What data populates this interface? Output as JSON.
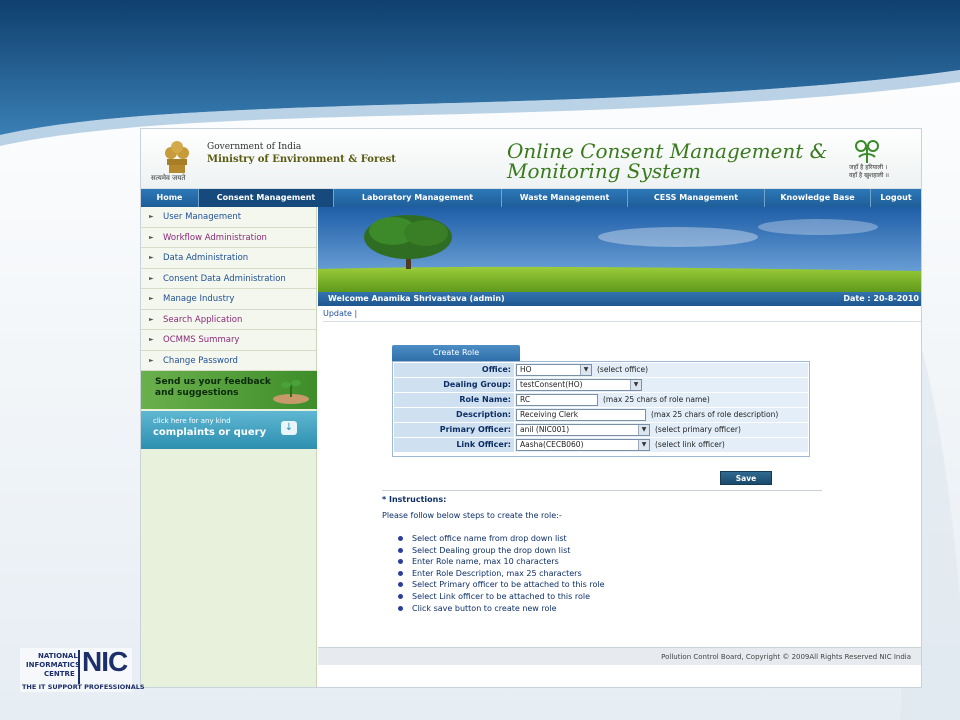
{
  "header": {
    "motto": "सत्यमेव जयते",
    "gov_line": "Government of India",
    "ministry_line": "Ministry of Environment & Forest",
    "app_title_line1": "Online Consent Management &",
    "app_title_line2": "Monitoring System",
    "env_logo_text_1": "जहाँ है हरियाली ।",
    "env_logo_text_2": "वहाँ है खुशहाली ॥"
  },
  "nav": {
    "items": [
      {
        "label": "Home"
      },
      {
        "label": "Consent Management"
      },
      {
        "label": "Laboratory Management"
      },
      {
        "label": "Waste Management"
      },
      {
        "label": "CESS Management"
      },
      {
        "label": "Knowledge Base"
      },
      {
        "label": "Logout"
      }
    ]
  },
  "sidebar": {
    "items": [
      {
        "label": "User Management"
      },
      {
        "label": "Workflow Administration"
      },
      {
        "label": "Data Administration"
      },
      {
        "label": "Consent Data Administration"
      },
      {
        "label": "Manage Industry"
      },
      {
        "label": "Search Application"
      },
      {
        "label": "OCMMS Summary"
      },
      {
        "label": "Change Password"
      }
    ],
    "feedback_line1": "Send us your feedback",
    "feedback_line2": "and suggestions",
    "complaint_line1": "click here for any kind",
    "complaint_line2": "complaints or query"
  },
  "content": {
    "welcome": "Welcome Anamika Shrivastava (admin)",
    "date": "Date : 20-8-2010",
    "update_link": "Update |",
    "form_tab": "Create Role",
    "form": {
      "office": {
        "label": "Office:",
        "value": "HO",
        "hint": "(select office)"
      },
      "dealing_group": {
        "label": "Dealing Group:",
        "value": "testConsent(HO)"
      },
      "role_name": {
        "label": "Role Name:",
        "value": "RC",
        "hint": "(max 25 chars of role name)"
      },
      "description": {
        "label": "Description:",
        "value": "Receiving Clerk",
        "hint": "(max 25 chars of role description)"
      },
      "primary_officer": {
        "label": "Primary Officer:",
        "value": "anil (NIC001)",
        "hint": "(select primary officer)"
      },
      "link_officer": {
        "label": "Link Officer:",
        "value": "Aasha(CECB060)",
        "hint": "(select link officer)"
      }
    },
    "save_label": "Save",
    "instructions_title": "* Instructions:",
    "instructions_intro": "Please follow below steps to create the role:-",
    "steps": [
      "Select office name from drop down list",
      "Select Dealing group the drop down list",
      "Enter Role name, max 10 characters",
      "Enter Role Description, max 25 characters",
      "Select Primary officer to be attached to this role",
      "Select Link officer to be attached to this role",
      "Click save button to create new role"
    ],
    "footer": "Pollution Control Board, Copyright © 2009All Rights Reserved NIC India"
  },
  "nic_logo": {
    "line1": "NATIONAL",
    "line2": "INFORMATICS",
    "line3": "CENTRE",
    "big": "NIC",
    "tagline": "THE IT SUPPORT PROFESSIONALS"
  },
  "colors": {
    "nav_blue": "#1e5e98",
    "title_green": "#3a7a1e",
    "label_bg": "#cfe0f0",
    "sidebar_bg": "#e8f1dc"
  }
}
